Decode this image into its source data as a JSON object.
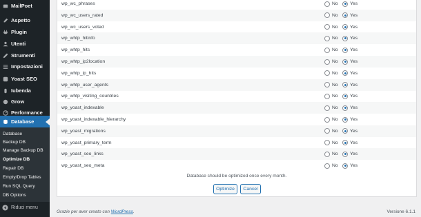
{
  "sidebar": {
    "items": [
      {
        "label": "MailPoet",
        "icon": "mailpoet-icon"
      },
      {
        "label": "Aspetto",
        "icon": "brush-icon"
      },
      {
        "label": "Plugin",
        "icon": "plugin-icon"
      },
      {
        "label": "Utenti",
        "icon": "users-icon"
      },
      {
        "label": "Strumenti",
        "icon": "wrench-icon"
      },
      {
        "label": "Impostazioni",
        "icon": "settings-icon"
      },
      {
        "label": "Yoast SEO",
        "icon": "yoast-icon"
      },
      {
        "label": "Iubenda",
        "icon": "iubenda-icon"
      },
      {
        "label": "Grow",
        "icon": "grow-icon"
      },
      {
        "label": "Performance",
        "icon": "performance-icon"
      },
      {
        "label": "Database",
        "icon": "database-icon"
      }
    ],
    "submenu": [
      {
        "label": "Database"
      },
      {
        "label": "Backup DB"
      },
      {
        "label": "Manage Backup DB"
      },
      {
        "label": "Optimize DB"
      },
      {
        "label": "Repair DB"
      },
      {
        "label": "Empty/Drop Tables"
      },
      {
        "label": "Run SQL Query"
      },
      {
        "label": "DB Options"
      }
    ],
    "collapse_label": "Riduci menu"
  },
  "table": {
    "no_label": "No",
    "yes_label": "Yes",
    "rows": [
      {
        "name": "wp_wc_phrases"
      },
      {
        "name": "wp_wc_users_rated"
      },
      {
        "name": "wp_wc_users_voted"
      },
      {
        "name": "wp_whtp_hitinfo"
      },
      {
        "name": "wp_whtp_hits"
      },
      {
        "name": "wp_whtp_ip2location"
      },
      {
        "name": "wp_whtp_ip_hits"
      },
      {
        "name": "wp_whtp_user_agents"
      },
      {
        "name": "wp_whtp_visiting_countries"
      },
      {
        "name": "wp_yoast_indexable"
      },
      {
        "name": "wp_yoast_indexable_hierarchy"
      },
      {
        "name": "wp_yoast_migrations"
      },
      {
        "name": "wp_yoast_primary_term"
      },
      {
        "name": "wp_yoast_seo_links"
      },
      {
        "name": "wp_yoast_seo_meta"
      }
    ]
  },
  "note": "Database should be optimized once every month.",
  "buttons": {
    "optimize": "Optimize",
    "cancel": "Cancel"
  },
  "footer": {
    "thanks_prefix": "Grazie per aver creato con ",
    "thanks_link": "WordPress",
    "thanks_suffix": ".",
    "version": "Versione 6.1.1"
  }
}
